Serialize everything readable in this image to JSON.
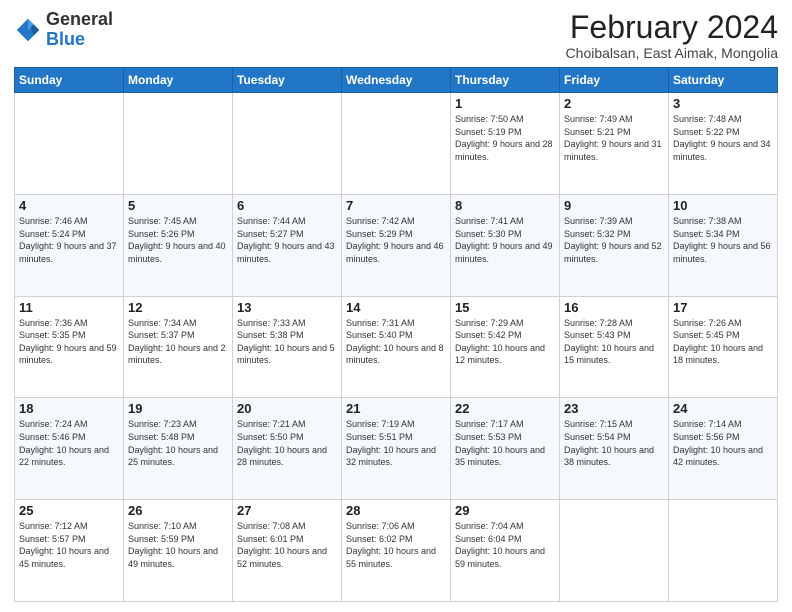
{
  "logo": {
    "general": "General",
    "blue": "Blue"
  },
  "header": {
    "title": "February 2024",
    "subtitle": "Choibalsan, East Aimak, Mongolia"
  },
  "weekdays": [
    "Sunday",
    "Monday",
    "Tuesday",
    "Wednesday",
    "Thursday",
    "Friday",
    "Saturday"
  ],
  "weeks": [
    [
      {
        "day": "",
        "info": ""
      },
      {
        "day": "",
        "info": ""
      },
      {
        "day": "",
        "info": ""
      },
      {
        "day": "",
        "info": ""
      },
      {
        "day": "1",
        "info": "Sunrise: 7:50 AM\nSunset: 5:19 PM\nDaylight: 9 hours and 28 minutes."
      },
      {
        "day": "2",
        "info": "Sunrise: 7:49 AM\nSunset: 5:21 PM\nDaylight: 9 hours and 31 minutes."
      },
      {
        "day": "3",
        "info": "Sunrise: 7:48 AM\nSunset: 5:22 PM\nDaylight: 9 hours and 34 minutes."
      }
    ],
    [
      {
        "day": "4",
        "info": "Sunrise: 7:46 AM\nSunset: 5:24 PM\nDaylight: 9 hours and 37 minutes."
      },
      {
        "day": "5",
        "info": "Sunrise: 7:45 AM\nSunset: 5:26 PM\nDaylight: 9 hours and 40 minutes."
      },
      {
        "day": "6",
        "info": "Sunrise: 7:44 AM\nSunset: 5:27 PM\nDaylight: 9 hours and 43 minutes."
      },
      {
        "day": "7",
        "info": "Sunrise: 7:42 AM\nSunset: 5:29 PM\nDaylight: 9 hours and 46 minutes."
      },
      {
        "day": "8",
        "info": "Sunrise: 7:41 AM\nSunset: 5:30 PM\nDaylight: 9 hours and 49 minutes."
      },
      {
        "day": "9",
        "info": "Sunrise: 7:39 AM\nSunset: 5:32 PM\nDaylight: 9 hours and 52 minutes."
      },
      {
        "day": "10",
        "info": "Sunrise: 7:38 AM\nSunset: 5:34 PM\nDaylight: 9 hours and 56 minutes."
      }
    ],
    [
      {
        "day": "11",
        "info": "Sunrise: 7:36 AM\nSunset: 5:35 PM\nDaylight: 9 hours and 59 minutes."
      },
      {
        "day": "12",
        "info": "Sunrise: 7:34 AM\nSunset: 5:37 PM\nDaylight: 10 hours and 2 minutes."
      },
      {
        "day": "13",
        "info": "Sunrise: 7:33 AM\nSunset: 5:38 PM\nDaylight: 10 hours and 5 minutes."
      },
      {
        "day": "14",
        "info": "Sunrise: 7:31 AM\nSunset: 5:40 PM\nDaylight: 10 hours and 8 minutes."
      },
      {
        "day": "15",
        "info": "Sunrise: 7:29 AM\nSunset: 5:42 PM\nDaylight: 10 hours and 12 minutes."
      },
      {
        "day": "16",
        "info": "Sunrise: 7:28 AM\nSunset: 5:43 PM\nDaylight: 10 hours and 15 minutes."
      },
      {
        "day": "17",
        "info": "Sunrise: 7:26 AM\nSunset: 5:45 PM\nDaylight: 10 hours and 18 minutes."
      }
    ],
    [
      {
        "day": "18",
        "info": "Sunrise: 7:24 AM\nSunset: 5:46 PM\nDaylight: 10 hours and 22 minutes."
      },
      {
        "day": "19",
        "info": "Sunrise: 7:23 AM\nSunset: 5:48 PM\nDaylight: 10 hours and 25 minutes."
      },
      {
        "day": "20",
        "info": "Sunrise: 7:21 AM\nSunset: 5:50 PM\nDaylight: 10 hours and 28 minutes."
      },
      {
        "day": "21",
        "info": "Sunrise: 7:19 AM\nSunset: 5:51 PM\nDaylight: 10 hours and 32 minutes."
      },
      {
        "day": "22",
        "info": "Sunrise: 7:17 AM\nSunset: 5:53 PM\nDaylight: 10 hours and 35 minutes."
      },
      {
        "day": "23",
        "info": "Sunrise: 7:15 AM\nSunset: 5:54 PM\nDaylight: 10 hours and 38 minutes."
      },
      {
        "day": "24",
        "info": "Sunrise: 7:14 AM\nSunset: 5:56 PM\nDaylight: 10 hours and 42 minutes."
      }
    ],
    [
      {
        "day": "25",
        "info": "Sunrise: 7:12 AM\nSunset: 5:57 PM\nDaylight: 10 hours and 45 minutes."
      },
      {
        "day": "26",
        "info": "Sunrise: 7:10 AM\nSunset: 5:59 PM\nDaylight: 10 hours and 49 minutes."
      },
      {
        "day": "27",
        "info": "Sunrise: 7:08 AM\nSunset: 6:01 PM\nDaylight: 10 hours and 52 minutes."
      },
      {
        "day": "28",
        "info": "Sunrise: 7:06 AM\nSunset: 6:02 PM\nDaylight: 10 hours and 55 minutes."
      },
      {
        "day": "29",
        "info": "Sunrise: 7:04 AM\nSunset: 6:04 PM\nDaylight: 10 hours and 59 minutes."
      },
      {
        "day": "",
        "info": ""
      },
      {
        "day": "",
        "info": ""
      }
    ]
  ]
}
